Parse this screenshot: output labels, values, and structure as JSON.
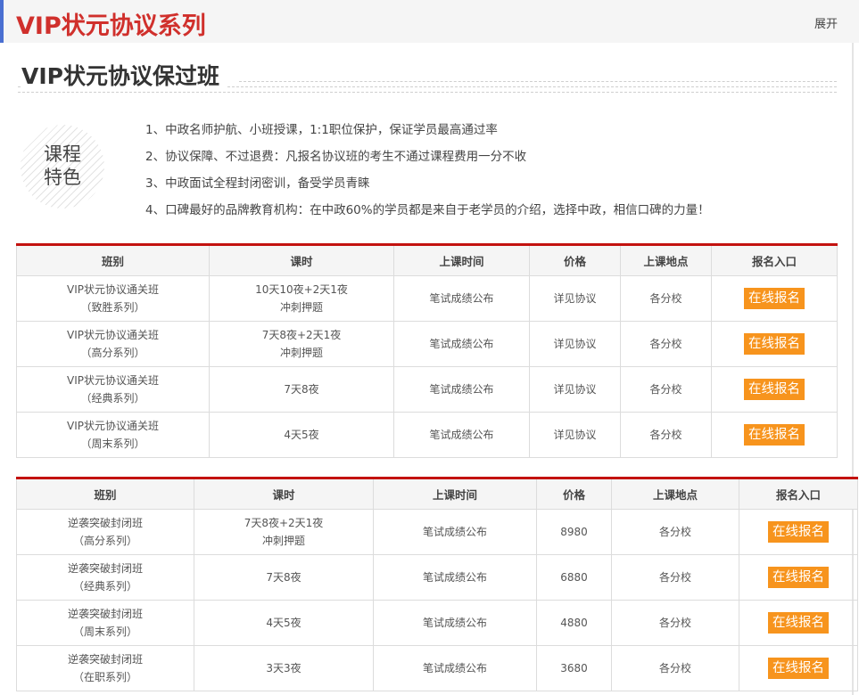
{
  "header": {
    "title": "VIP状元协议系列",
    "expand_label": "展开"
  },
  "section_title": "VIP状元协议保过班",
  "feature_badge": {
    "line1": "课程",
    "line2": "特色"
  },
  "features": [
    "1、中政名师护航、小班授课，1:1职位保护，保证学员最高通过率",
    "2、协议保障、不过退费：凡报名协议班的考生不通过课程费用一分不收",
    "3、中政面试全程封闭密训，备受学员青睐",
    "4、口碑最好的品牌教育机构：在中政60%的学员都是来自于老学员的介绍，选择中政，相信口碑的力量！"
  ],
  "table1": {
    "headers": [
      "班别",
      "课时",
      "上课时间",
      "价格",
      "上课地点",
      "报名入口"
    ],
    "rows": [
      {
        "name": "VIP状元协议通关班",
        "series": "（致胜系列）",
        "hours": "10天10夜+2天1夜",
        "hours_note": "冲刺押题",
        "time": "笔试成绩公布",
        "price": "详见协议",
        "place": "各分校",
        "signup": "在线报名"
      },
      {
        "name": "VIP状元协议通关班",
        "series": "（高分系列）",
        "hours": "7天8夜+2天1夜",
        "hours_note": "冲刺押题",
        "time": "笔试成绩公布",
        "price": "详见协议",
        "place": "各分校",
        "signup": "在线报名"
      },
      {
        "name": "VIP状元协议通关班",
        "series": "（经典系列）",
        "hours": "7天8夜",
        "hours_note": "",
        "time": "笔试成绩公布",
        "price": "详见协议",
        "place": "各分校",
        "signup": "在线报名"
      },
      {
        "name": "VIP状元协议通关班",
        "series": "（周末系列）",
        "hours": "4天5夜",
        "hours_note": "",
        "time": "笔试成绩公布",
        "price": "详见协议",
        "place": "各分校",
        "signup": "在线报名"
      }
    ]
  },
  "table2": {
    "headers": [
      "班别",
      "课时",
      "上课时间",
      "价格",
      "上课地点",
      "报名入口"
    ],
    "rows": [
      {
        "name": "逆袭突破封闭班",
        "series": "（高分系列）",
        "hours": "7天8夜+2天1夜",
        "hours_note": "冲刺押题",
        "time": "笔试成绩公布",
        "price": "8980",
        "place": "各分校",
        "signup": "在线报名"
      },
      {
        "name": "逆袭突破封闭班",
        "series": "（经典系列）",
        "hours": "7天8夜",
        "hours_note": "",
        "time": "笔试成绩公布",
        "price": "6880",
        "place": "各分校",
        "signup": "在线报名"
      },
      {
        "name": "逆袭突破封闭班",
        "series": "（周末系列）",
        "hours": "4天5夜",
        "hours_note": "",
        "time": "笔试成绩公布",
        "price": "4880",
        "place": "各分校",
        "signup": "在线报名"
      },
      {
        "name": "逆袭突破封闭班",
        "series": "（在职系列）",
        "hours": "3天3夜",
        "hours_note": "",
        "time": "笔试成绩公布",
        "price": "3680",
        "place": "各分校",
        "signup": "在线报名"
      }
    ]
  },
  "colors": {
    "title_red": "#d0302c",
    "table_top_border": "#c3120f",
    "button_orange": "#f7941d",
    "left_accent": "#4a6fd1"
  }
}
